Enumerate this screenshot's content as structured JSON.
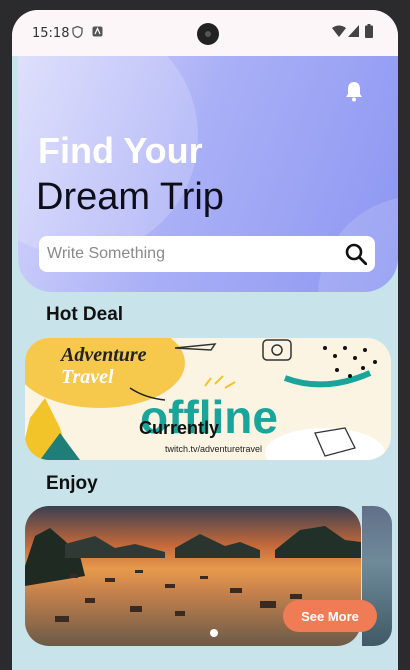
{
  "status_bar": {
    "time": "15:18"
  },
  "hero": {
    "title_line1": "Find Your",
    "title_line2": "Dream Trip",
    "search_placeholder": "Write Something"
  },
  "sections": {
    "hot_deal": "Hot Deal",
    "enjoy": "Enjoy"
  },
  "banner": {
    "adventure": "Adventure",
    "travel": "Travel",
    "offline": "offline",
    "currently": "Currently",
    "url": "twitch.tv/adventuretravel"
  },
  "carousel": {
    "see_more": "See More",
    "pages": 2,
    "active_page": 1
  },
  "colors": {
    "accent": "#f07c55",
    "hero_gradient_start": "#d8d9fb",
    "hero_gradient_end": "#8c96f2",
    "background": "#c8e3ea",
    "teal": "#1aa59a"
  },
  "icons": [
    "bell-icon",
    "search-icon",
    "wifi-icon",
    "signal-icon",
    "battery-icon"
  ]
}
